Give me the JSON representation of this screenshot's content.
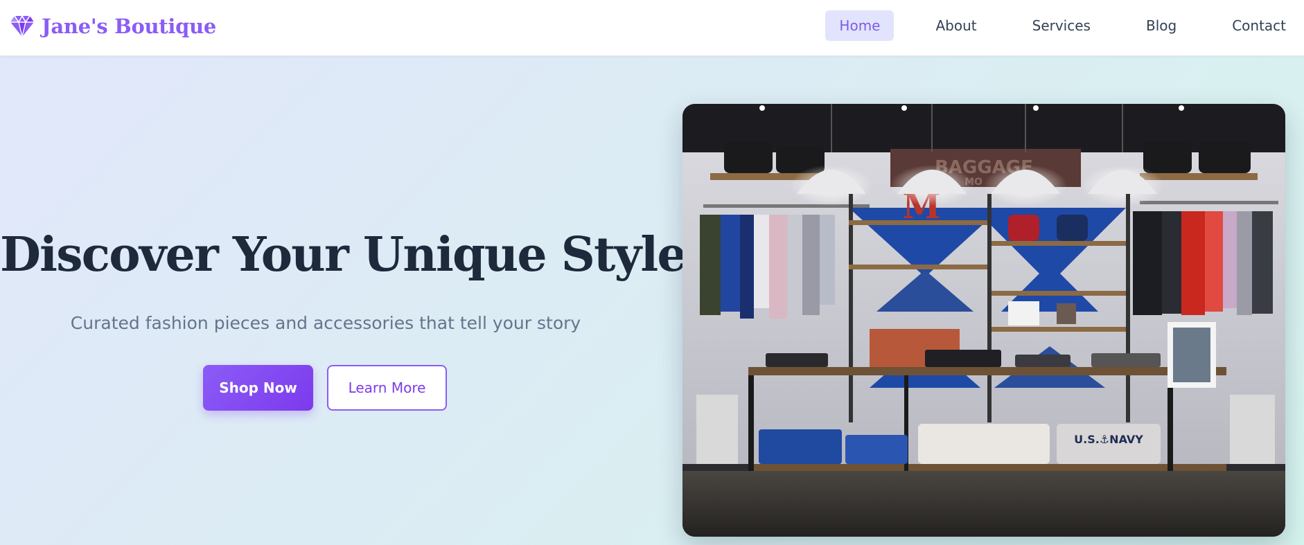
{
  "brand": {
    "name": "Jane's Boutique",
    "icon": "gem-icon",
    "color": "#8b5cf6"
  },
  "nav": {
    "items": [
      {
        "label": "Home",
        "active": true
      },
      {
        "label": "About",
        "active": false
      },
      {
        "label": "Services",
        "active": false
      },
      {
        "label": "Blog",
        "active": false
      },
      {
        "label": "Contact",
        "active": false
      }
    ]
  },
  "hero": {
    "title": "Discover Your Unique Style",
    "subtitle": "Curated fashion pieces and accessories that tell your story",
    "primary_button": "Shop Now",
    "secondary_button": "Learn More",
    "image": {
      "sign_text": "BAGGAGE",
      "sign_subtext": "MO",
      "sign_letter": "M",
      "shirt_text": "U.S.⚓NAVY"
    }
  },
  "colors": {
    "accent": "#8b5cf6",
    "accent_dark": "#7c3aed",
    "title": "#1e293b",
    "subtitle": "#64748b",
    "nav_text": "#334155",
    "nav_active_bg": "#e2e4fd"
  }
}
